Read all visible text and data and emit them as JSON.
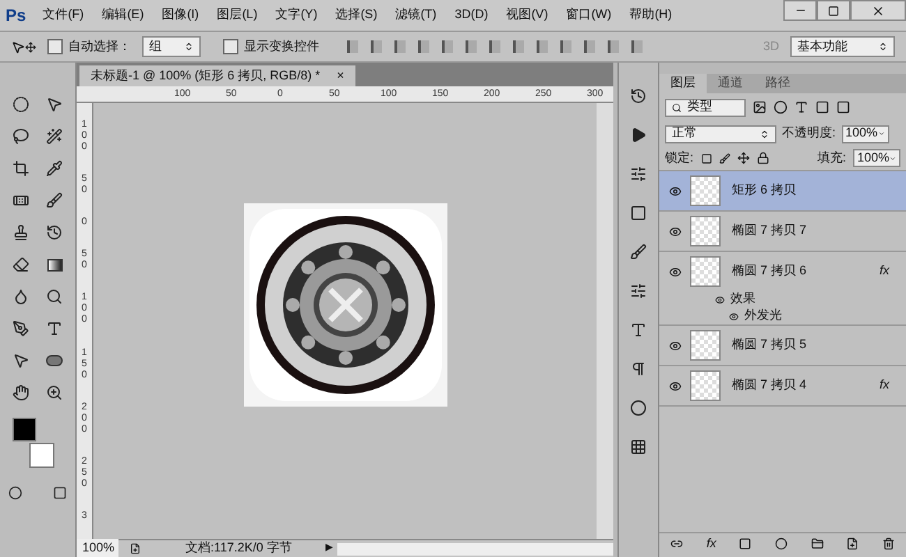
{
  "app_logo": "Ps",
  "menu": [
    "文件(F)",
    "编辑(E)",
    "图像(I)",
    "图层(L)",
    "文字(Y)",
    "选择(S)",
    "滤镜(T)",
    "3D(D)",
    "视图(V)",
    "窗口(W)",
    "帮助(H)"
  ],
  "options_bar": {
    "auto_select": {
      "label": "自动选择：",
      "checked": false,
      "value": "组"
    },
    "show_transform": {
      "label": "显示变换控件",
      "checked": false
    },
    "mode_3d": "3D",
    "workspace": "基本功能"
  },
  "document_tab": {
    "title": "未标题-1 @ 100% (矩形 6 拷贝, RGB/8) *",
    "close": "×"
  },
  "ruler_h": [
    "100",
    "50",
    "0",
    "50",
    "100",
    "150",
    "200",
    "250",
    "300"
  ],
  "ruler_v": [
    "100",
    "50",
    "0",
    "50",
    "100",
    "150",
    "200",
    "250",
    "3"
  ],
  "status_bar": {
    "zoom": "100%",
    "info": "文档:117.2K/0 字节",
    "arrow": "▶"
  },
  "layers_panel": {
    "tabs": [
      {
        "label": "图层",
        "selected": true
      },
      {
        "label": "通道",
        "selected": false
      },
      {
        "label": "路径",
        "selected": false
      }
    ],
    "filter": "类型",
    "blend_mode": "正常",
    "opacity_label": "不透明度:",
    "opacity": "100%",
    "lock_label": "锁定:",
    "fill_label": "填充:",
    "fill": "100%",
    "layers": [
      {
        "name": "矩形 6 拷贝",
        "visible": true,
        "selected": true
      },
      {
        "name": "椭圆 7 拷贝 7",
        "visible": true,
        "selected": false
      },
      {
        "name": "椭圆 7 拷贝 6",
        "visible": true,
        "selected": false,
        "fx_badge": "fx",
        "effects_label": "效果",
        "effects": [
          "外发光"
        ]
      },
      {
        "name": "椭圆 7 拷贝 5",
        "visible": true,
        "selected": false
      },
      {
        "name": "椭圆 7 拷贝 4",
        "visible": true,
        "selected": false,
        "fx_badge": "fx"
      }
    ],
    "add_style_label": "fx"
  }
}
